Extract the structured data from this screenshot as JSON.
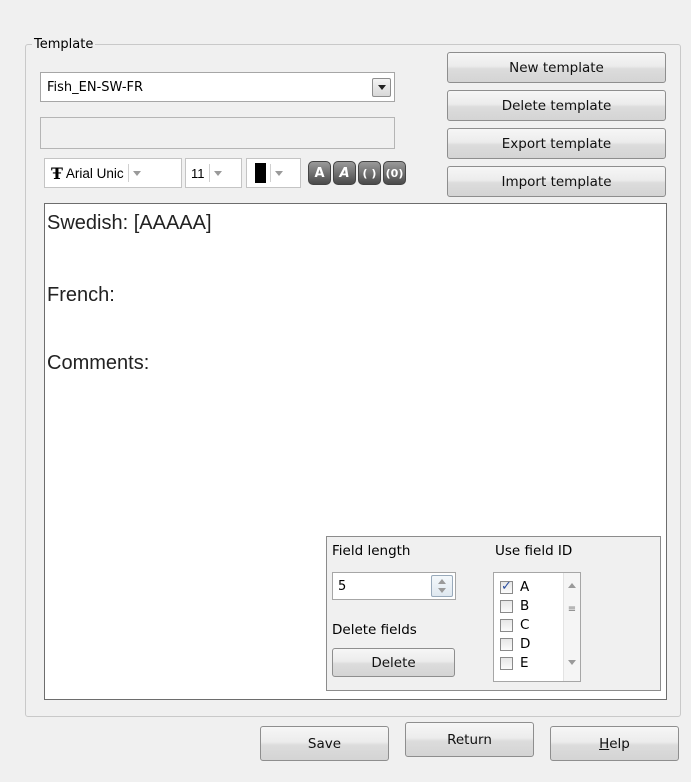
{
  "template_group": {
    "title": "Template",
    "selected_template": "Fish_EN-SW-FR",
    "name_field_value": ""
  },
  "buttons": {
    "new_template": "New template",
    "delete_template": "Delete template",
    "export_template": "Export template",
    "import_template": "Import template"
  },
  "toolbar": {
    "font_name": "Arial Unic",
    "font_size": "11",
    "text_color": "#000000",
    "format_buttons": [
      "A",
      "A",
      "( )",
      "(0)"
    ]
  },
  "editor": {
    "lines": [
      "Swedish: [AAAAA]",
      "French:",
      "Comments:"
    ]
  },
  "field_panel": {
    "field_length_label": "Field length",
    "field_length_value": "5",
    "use_field_id_label": "Use field ID",
    "delete_fields_label": "Delete fields",
    "delete_button": "Delete",
    "field_ids": [
      {
        "id": "A",
        "checked": true
      },
      {
        "id": "B",
        "checked": false
      },
      {
        "id": "C",
        "checked": false
      },
      {
        "id": "D",
        "checked": false
      },
      {
        "id": "E",
        "checked": false
      }
    ]
  },
  "footer": {
    "save": "Save",
    "return": "Return",
    "help_prefix": "",
    "help_mnemonic": "H",
    "help_rest": "elp"
  }
}
